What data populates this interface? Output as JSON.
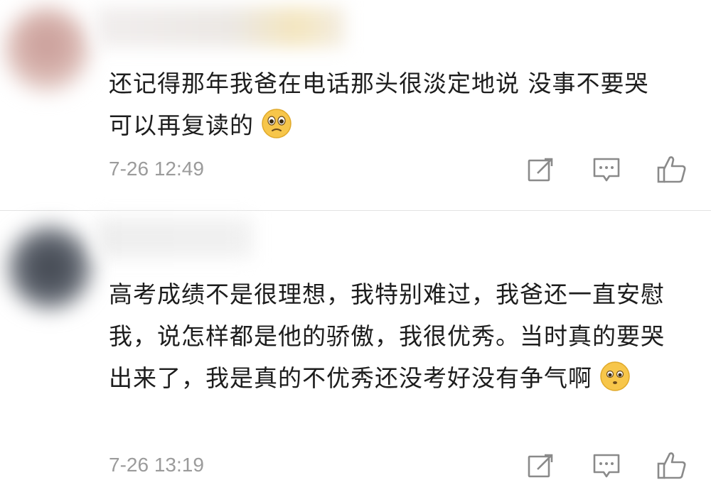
{
  "comments": [
    {
      "text": "还记得那年我爸在电话那头很淡定地说 没事不要哭 可以再复读的",
      "emoji": "pleading-face-icon",
      "timestamp": "7-26 12:49"
    },
    {
      "text": "高考成绩不是很理想，我特别难过，我爸还一直安慰我，说怎样都是他的骄傲，我很优秀。当时真的要哭出来了，我是真的不优秀还没考好没有争气啊",
      "emoji": "pleading-face-icon",
      "timestamp": "7-26 13:19"
    }
  ],
  "icons": {
    "forward": "share-icon",
    "comment": "comment-icon",
    "like": "thumbs-up-icon"
  },
  "colors": {
    "text": "#1d1d1d",
    "meta": "#9b9b9b",
    "divider": "#e3e3e3",
    "emoji_face": "#f7c64a"
  }
}
